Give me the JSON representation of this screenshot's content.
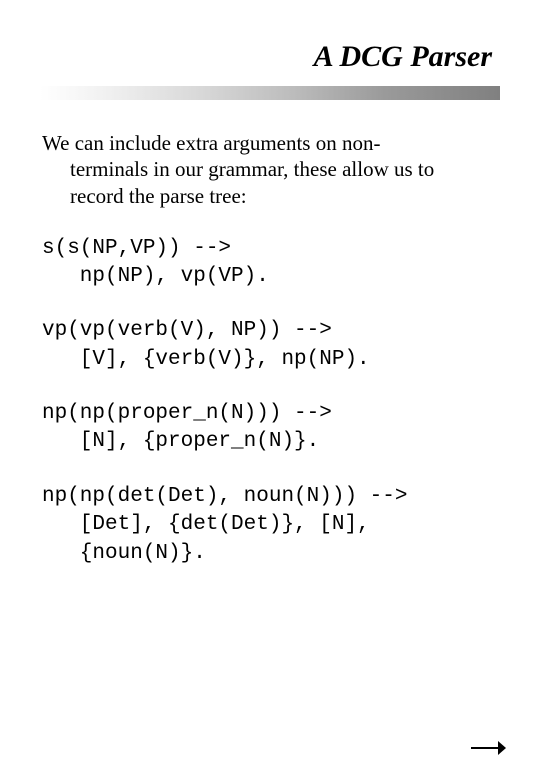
{
  "title": "A DCG Parser",
  "intro": {
    "line1": "We can include extra arguments on non-",
    "line2": "terminals in our grammar, these allow us to",
    "line3": "record the parse tree:"
  },
  "code": {
    "block1": "s(s(NP,VP)) -->\n   np(NP), vp(VP).",
    "block2": "vp(vp(verb(V), NP)) -->\n   [V], {verb(V)}, np(NP).",
    "block3": "np(np(proper_n(N))) -->\n   [N], {proper_n(N)}.",
    "block4": "np(np(det(Det), noun(N))) -->\n   [Det], {det(Det)}, [N],\n   {noun(N)}."
  },
  "nav": {
    "next_icon": "arrow-right"
  }
}
